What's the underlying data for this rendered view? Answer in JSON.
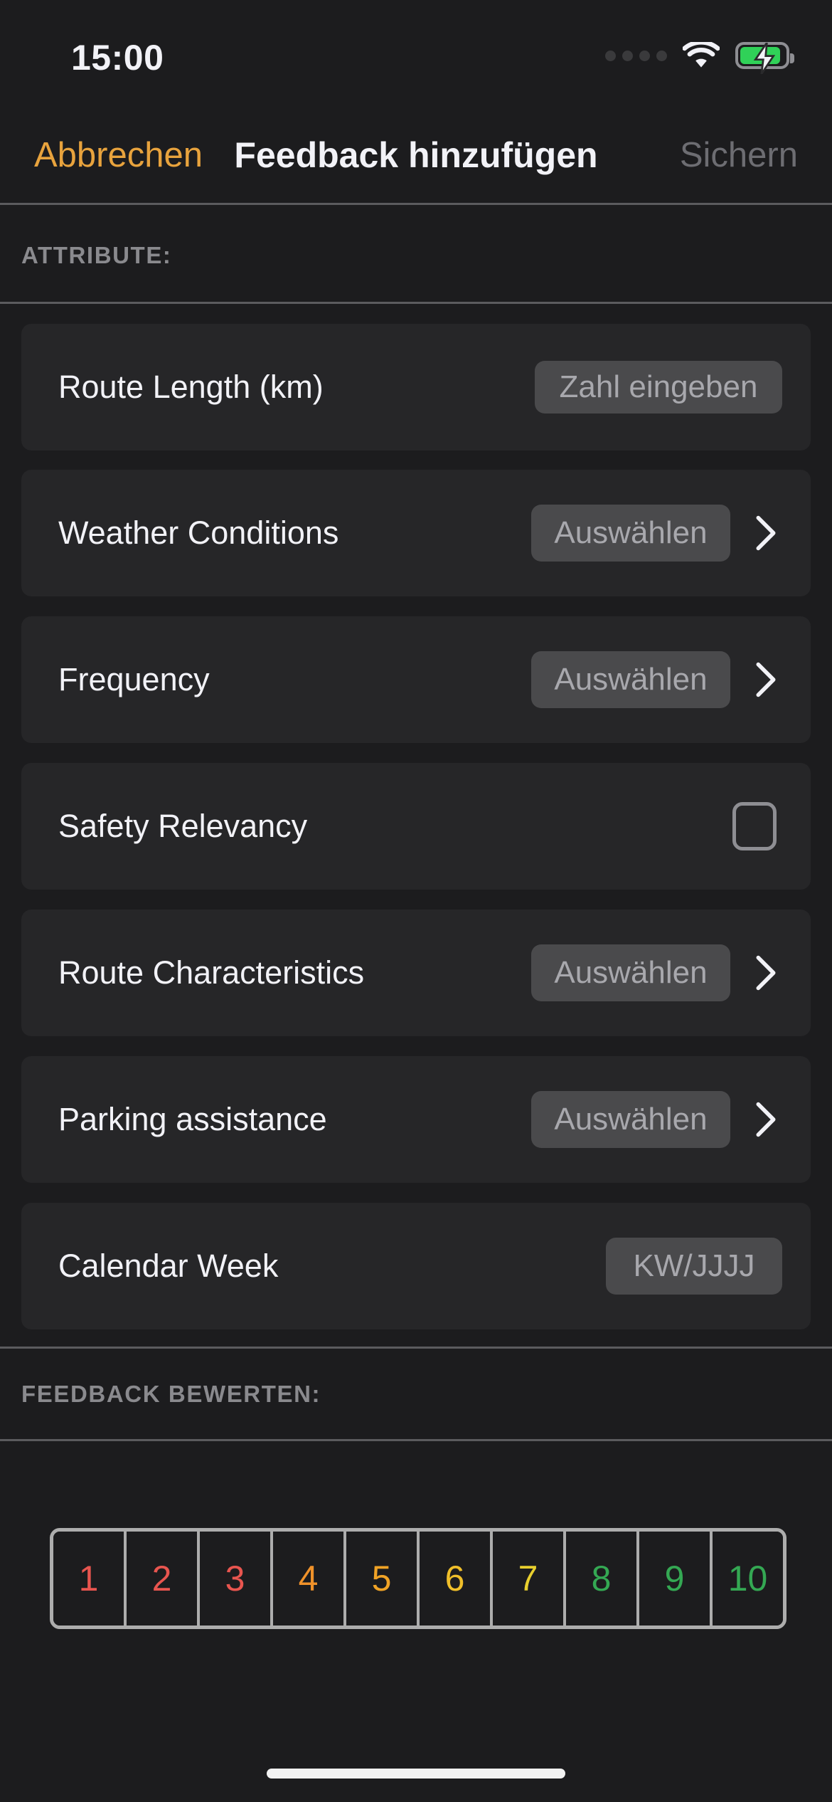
{
  "status_bar": {
    "time": "15:00",
    "signal_icon": "signal-dots-icon",
    "wifi_icon": "wifi-icon",
    "battery_icon": "battery-charging-icon",
    "battery_color": "#30d158"
  },
  "nav_bar": {
    "cancel_label": "Abbrechen",
    "title": "Feedback hinzufügen",
    "save_label": "Sichern",
    "cancel_color": "#e8a33d",
    "save_color": "#6d6d72"
  },
  "sections": {
    "attributes_header": "ATTRIBUTE:",
    "rating_header": "FEEDBACK BEWERTEN:"
  },
  "attributes": [
    {
      "label": "Route Length (km)",
      "control": "textfield",
      "placeholder": "Zahl eingeben",
      "chevron": false
    },
    {
      "label": "Weather Conditions",
      "control": "picker",
      "placeholder": "Auswählen",
      "chevron": true
    },
    {
      "label": "Frequency",
      "control": "picker",
      "placeholder": "Auswählen",
      "chevron": true
    },
    {
      "label": "Safety Relevancy",
      "control": "checkbox",
      "placeholder": "",
      "checked": false,
      "chevron": false
    },
    {
      "label": "Route Characteristics",
      "control": "picker",
      "placeholder": "Auswählen",
      "chevron": true
    },
    {
      "label": "Parking assistance",
      "control": "picker",
      "placeholder": "Auswählen",
      "chevron": true
    },
    {
      "label": "Calendar Week",
      "control": "textfield",
      "placeholder": "KW/JJJJ",
      "chevron": false
    }
  ],
  "rating": {
    "selected": null,
    "cells": [
      {
        "value": "1",
        "color": "#e8554f"
      },
      {
        "value": "2",
        "color": "#e8554f"
      },
      {
        "value": "3",
        "color": "#e8554f"
      },
      {
        "value": "4",
        "color": "#f0922a"
      },
      {
        "value": "5",
        "color": "#f0a326"
      },
      {
        "value": "6",
        "color": "#f0bf2a"
      },
      {
        "value": "7",
        "color": "#e8cf2e"
      },
      {
        "value": "8",
        "color": "#34a853"
      },
      {
        "value": "9",
        "color": "#34a853"
      },
      {
        "value": "10",
        "color": "#34a853"
      }
    ]
  },
  "home_indicator": "home-indicator"
}
